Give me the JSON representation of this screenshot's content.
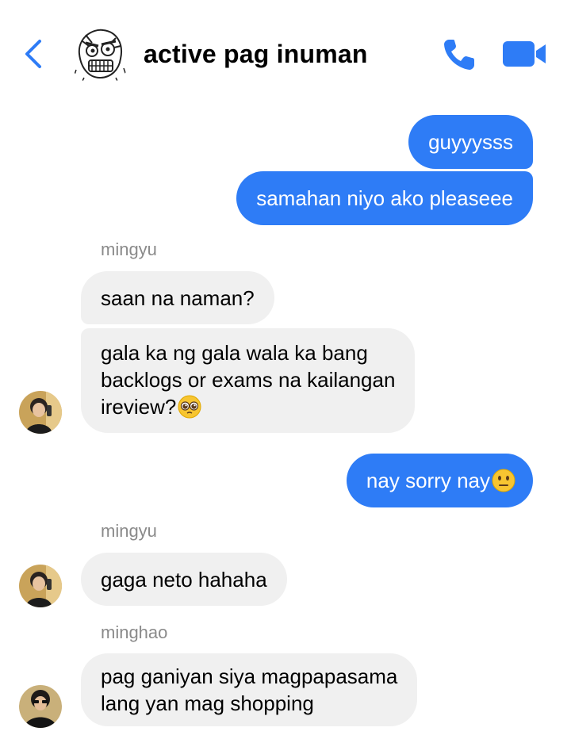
{
  "header": {
    "title": "active pag inuman",
    "back_icon": "chevron-left-icon",
    "call_icon": "phone-icon",
    "video_icon": "video-camera-icon",
    "accent_color": "#2e7cf6"
  },
  "messages": [
    {
      "from": "me",
      "text": "guyyysss"
    },
    {
      "from": "me",
      "text": "samahan niyo ako pleaseee"
    },
    {
      "sender": "mingyu"
    },
    {
      "from": "mingyu",
      "text": "saan na naman?"
    },
    {
      "from": "mingyu",
      "lines": [
        "gala ka ng gala wala ka bang",
        "backlogs or exams na kailangan",
        "ireview?"
      ],
      "emoji": "pleading-face-emoji"
    },
    {
      "from": "me",
      "text": "nay sorry nay",
      "emoji": "neutral-face-emoji"
    },
    {
      "sender": "mingyu"
    },
    {
      "from": "mingyu",
      "text": "gaga neto hahaha"
    },
    {
      "sender": "minghao"
    },
    {
      "from": "minghao",
      "lines": [
        "pag ganiyan siya magpapasama",
        "lang yan mag shopping"
      ]
    }
  ],
  "labels": {
    "mingyu_1": "mingyu",
    "mingyu_2": "mingyu",
    "minghao": "minghao"
  },
  "colors": {
    "outgoing_bubble": "#2e7cf6",
    "incoming_bubble": "#f0f0f0",
    "sender_label": "#8a8a8a"
  }
}
